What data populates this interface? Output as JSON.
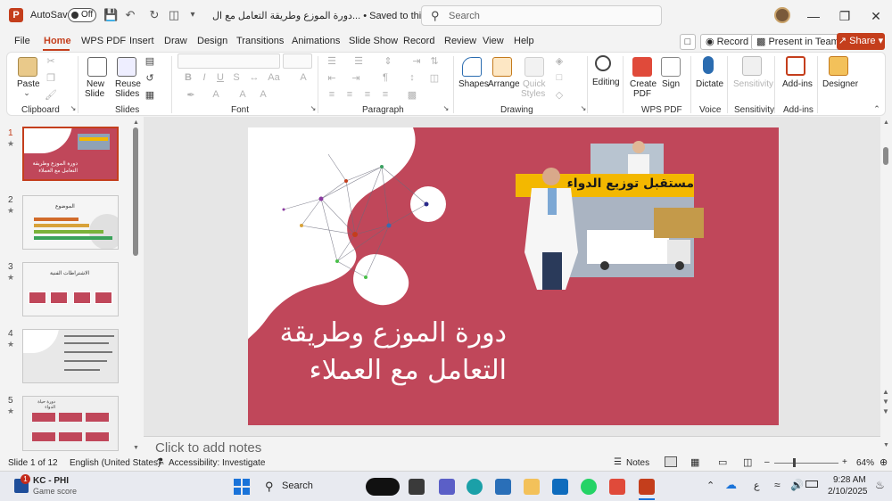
{
  "window": {
    "app_logo": "P",
    "autosave_label": "AutoSave",
    "autosave_state": "Off",
    "doc_title": "دورة الموزع وطريقة التعامل مع ال... • Saved to this PC",
    "search_placeholder": "Search"
  },
  "menu": {
    "tabs": [
      "File",
      "Home",
      "WPS PDF",
      "Insert",
      "Draw",
      "Design",
      "Transitions",
      "Animations",
      "Slide Show",
      "Record",
      "Review",
      "View",
      "Help"
    ],
    "active": "Home",
    "record_label": "Record",
    "present_label": "Present in Teams",
    "share_label": "Share"
  },
  "ribbon": {
    "clipboard": {
      "paste": "Paste",
      "group": "Clipboard"
    },
    "slides": {
      "new_slide": "New Slide",
      "new_slide_l1": "New",
      "new_slide_l2": "Slide",
      "reuse_l1": "Reuse",
      "reuse_l2": "Slides",
      "group": "Slides"
    },
    "font": {
      "group": "Font"
    },
    "paragraph": {
      "group": "Paragraph"
    },
    "drawing": {
      "shapes": "Shapes",
      "arrange": "Arrange",
      "quick_l1": "Quick",
      "quick_l2": "Styles",
      "group": "Drawing"
    },
    "editing": {
      "label": "Editing"
    },
    "wps": {
      "create_l1": "Create",
      "create_l2": "PDF",
      "sign": "Sign",
      "group": "WPS PDF"
    },
    "voice": {
      "dictate": "Dictate",
      "group": "Voice"
    },
    "sensitivity": {
      "label": "Sensitivity",
      "group": "Sensitivity"
    },
    "addins": {
      "label": "Add-ins",
      "group": "Add-ins"
    },
    "designer": {
      "label": "Designer"
    }
  },
  "thumbnails": [
    {
      "num": "1",
      "title": "دورة الموزع وطريقة التعامل مع العملاء"
    },
    {
      "num": "2",
      "title": "الموضوع"
    },
    {
      "num": "3",
      "title": "الاشتراطات الفنية"
    },
    {
      "num": "4",
      "title": ""
    },
    {
      "num": "5",
      "title": "دورة حياة الدواء"
    }
  ],
  "slide": {
    "title_line1": "دورة الموزع وطريقة",
    "title_line2": "التعامل مع العملاء",
    "banner": "مستقبل توزيع الدواء",
    "bg_color": "#c0475a"
  },
  "notes_placeholder": "Click to add notes",
  "statusbar": {
    "slide_info": "Slide 1 of 12",
    "language": "English (United States)",
    "accessibility": "Accessibility: Investigate",
    "notes": "Notes",
    "zoom": "64%"
  },
  "taskbar": {
    "weather_title": "KC - PHI",
    "weather_sub": "Game score",
    "badge": "1",
    "search": "Search",
    "lang": "ع",
    "time": "9:28 AM",
    "date": "2/10/2025"
  }
}
